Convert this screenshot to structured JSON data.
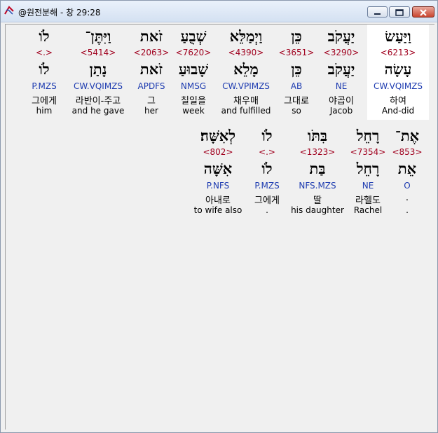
{
  "window": {
    "title": "@원전분해 - 창 29:28",
    "icon": "app-swirl-icon",
    "controls": [
      "minimize-icon",
      "maximize-icon",
      "close-icon"
    ]
  },
  "colors": {
    "strong": "#a0001e",
    "morph": "#1d3bb0",
    "highlight_bg": "#ffffff"
  },
  "verse": {
    "row1": [
      {
        "heb": "לֹו",
        "strong": "<.>",
        "lemma": "לֹו",
        "morph": "P.MZS",
        "kor": "그에게",
        "eng": "him"
      },
      {
        "heb": "וַיִּתֶּן־",
        "strong": "<5414>",
        "lemma": "נָתַן",
        "morph": "CW.VQIMZS",
        "kor": "라반이-주고",
        "eng": "and he gave"
      },
      {
        "heb": "זֹאת",
        "strong": "<2063>",
        "lemma": "זֹאת",
        "morph": "APDFS",
        "kor": "그",
        "eng": "her"
      },
      {
        "heb": "שְׁבֻעַ",
        "strong": "<7620>",
        "lemma": "שָׁבוּעַ",
        "morph": "NMSG",
        "kor": "칠일을",
        "eng": "week"
      },
      {
        "heb": "וַיְמַלֵּא",
        "strong": "<4390>",
        "lemma": "מָלֵא",
        "morph": "CW.VPIMZS",
        "kor": "채우매",
        "eng": "and fulfilled"
      },
      {
        "heb": "כֵּן",
        "strong": "<3651>",
        "lemma": "כֵּן",
        "morph": "AB",
        "kor": "그대로",
        "eng": "so"
      },
      {
        "heb": "יַעֲקֹב",
        "strong": "<3290>",
        "lemma": "יַעֲקֹב",
        "morph": "NE",
        "kor": "야곱이",
        "eng": "Jacob"
      },
      {
        "heb": "וַיַּעַשׂ",
        "strong": "<6213>",
        "lemma": "עָשָׂה",
        "morph": "CW.VQIMZS",
        "kor": "하여",
        "eng": "And-did"
      }
    ],
    "row2": [
      {
        "heb": "לְאִשָּׁה׃",
        "strong": "<802>",
        "lemma": "אִשָּׁה",
        "morph": "P.NFS",
        "kor": "아내로",
        "eng": "to wife also"
      },
      {
        "heb": "לֹו",
        "strong": "<.>",
        "lemma": "לֹו",
        "morph": "P.MZS",
        "kor": "그에게",
        "eng": "."
      },
      {
        "heb": "בִּתֹּו",
        "strong": "<1323>",
        "lemma": "בַּת",
        "morph": "NFS.MZS",
        "kor": "딸",
        "eng": "his daughter"
      },
      {
        "heb": "רָחֵל",
        "strong": "<7354>",
        "lemma": "רָחֵל",
        "morph": "NE",
        "kor": "라헬도",
        "eng": "Rachel"
      },
      {
        "heb": "אֶת־",
        "strong": "<853>",
        "lemma": "אֵת",
        "morph": "O",
        "kor": ".",
        "eng": "."
      }
    ]
  }
}
